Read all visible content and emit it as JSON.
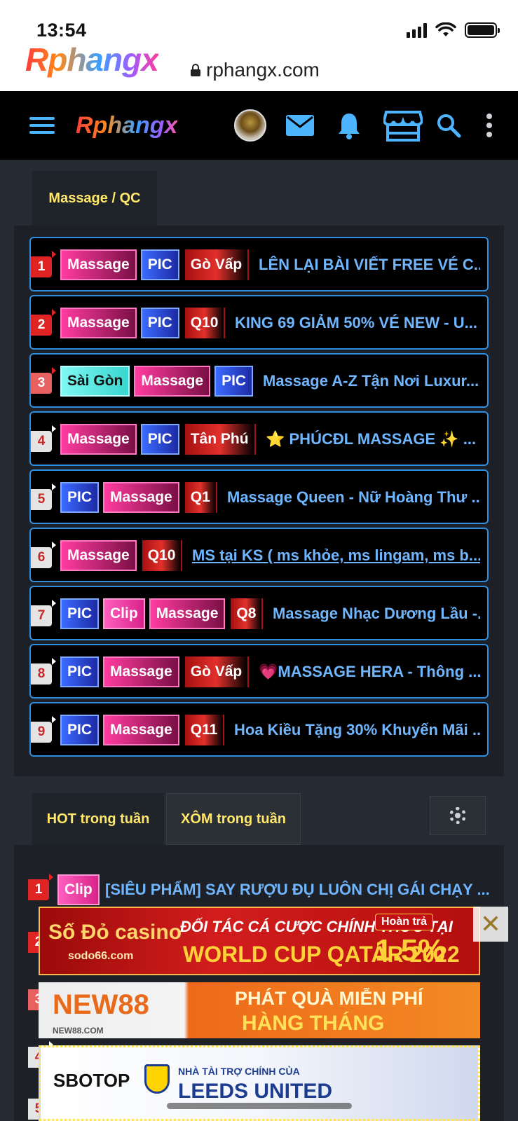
{
  "status_bar": {
    "time": "13:54"
  },
  "browser": {
    "site_logo": "Rphangx",
    "url": "rphangx.com"
  },
  "nav": {
    "logo": "Rphangx"
  },
  "section1": {
    "tab_label": "Massage / QC",
    "rows": [
      {
        "num": "1",
        "tags": [
          "Massage",
          "PIC",
          "Gò Vấp"
        ],
        "title": "LÊN LẠI BÀI VIẾT FREE VÉ C..."
      },
      {
        "num": "2",
        "tags": [
          "Massage",
          "PIC",
          "Q10"
        ],
        "title": "KING 69 GIẢM 50% VÉ NEW - U..."
      },
      {
        "num": "3",
        "tags": [
          "Sài Gòn",
          "Massage",
          "PIC"
        ],
        "title": "Massage A-Z Tận Nơi Luxur..."
      },
      {
        "num": "4",
        "tags": [
          "Massage",
          "PIC",
          "Tân Phú"
        ],
        "title": "⭐ PHÚCĐL MASSAGE ✨ ..."
      },
      {
        "num": "5",
        "tags": [
          "PIC",
          "Massage",
          "Q1"
        ],
        "title": "Massage Queen - Nữ Hoàng Thư ..."
      },
      {
        "num": "6",
        "tags": [
          "Massage",
          "Q10"
        ],
        "title": "MS tại KS ( ms khỏe, ms lingam, ms b..."
      },
      {
        "num": "7",
        "tags": [
          "PIC",
          "Clip",
          "Massage",
          "Q8"
        ],
        "title": "Massage Nhạc Dương Lầu -..."
      },
      {
        "num": "8",
        "tags": [
          "PIC",
          "Massage",
          "Gò Vấp"
        ],
        "title": "💗MASSAGE HERA - Thông ..."
      },
      {
        "num": "9",
        "tags": [
          "PIC",
          "Massage",
          "Q11"
        ],
        "title": "Hoa Kiều Tặng 30% Khuyến Mãi ..."
      }
    ]
  },
  "section2": {
    "tabs": [
      "HOT trong tuần",
      "XÔM trong tuần"
    ],
    "rows": [
      {
        "num": "1",
        "tags": [
          "Clip"
        ],
        "title": "[SIÊU PHẨM] SAY RƯỢU ĐỤ LUÔN CHỊ GÁI CHẠY ..."
      },
      {
        "num": "2"
      },
      {
        "num": "3"
      },
      {
        "num": "4"
      },
      {
        "num": "5"
      }
    ]
  },
  "ads": [
    {
      "brand": "Số Đỏ casino",
      "domain": "sodo66.com",
      "line1": "ĐỐI TÁC CÁ CƯỢC CHÍNH THỨC TẠI",
      "line2": "WORLD CUP QATAR 2022",
      "badge": "Hoàn trả",
      "badge_value": "1.5%"
    },
    {
      "brand": "NEW88",
      "domain": "NEW88.COM",
      "line1": "PHÁT QUÀ MIỄN PHÍ",
      "line2": "HÀNG THÁNG"
    },
    {
      "brand": "SBOTOP",
      "line1": "NHÀ TÀI TRỢ CHÍNH CỦA",
      "line2": "LEEDS UNITED"
    }
  ],
  "colors": {
    "accent": "#4db5ff",
    "tab_text": "#ffe76a",
    "row_border": "#2e8fe0",
    "title": "#6fb6ff"
  }
}
